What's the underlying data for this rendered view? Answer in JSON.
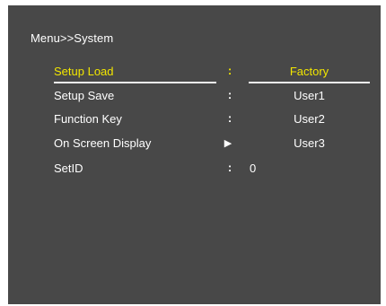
{
  "header": {
    "breadcrumb": "Menu>>System"
  },
  "menu": {
    "items": [
      {
        "label": "Setup Load",
        "separator": ":",
        "selected": true
      },
      {
        "label": "Setup Save",
        "separator": ":"
      },
      {
        "label": "Function Key",
        "separator": ":"
      },
      {
        "label": "On Screen Display",
        "separator": "▶"
      },
      {
        "label": "SetID",
        "separator": ":",
        "value": "0"
      }
    ]
  },
  "submenu": {
    "options": [
      "Factory",
      "User1",
      "User2",
      "User3"
    ],
    "selected": "Factory"
  },
  "colors": {
    "background": "#484848",
    "text": "#ffffff",
    "highlight": "#f2e600"
  }
}
